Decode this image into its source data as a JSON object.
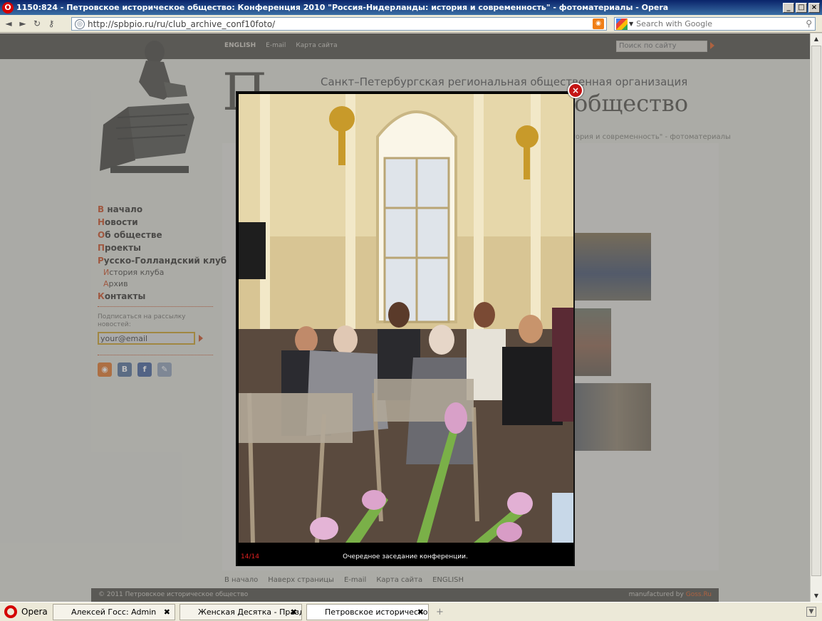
{
  "window": {
    "title": "1150:824 - Петровское историческое общество: Конференция 2010 \"Россия-Нидерланды: история и современность\" - фотоматериалы - Opera"
  },
  "address_bar": {
    "url": "http://spbpio.ru/ru/club_archive_conf10foto/",
    "search_placeholder": "Search with Google"
  },
  "site": {
    "top_links": {
      "english": "ENGLISH",
      "email": "E-mail",
      "sitemap": "Карта сайта"
    },
    "site_search_placeholder": "Поиск по сайту",
    "org_line": "Санкт–Петербургская региональная общественная организация",
    "header_big_letter": "П",
    "header_big_word": "общество",
    "breadcrumb_tail": "история и современность\" - фотоматериалы",
    "menu": [
      {
        "first": "В",
        "rest": " начало"
      },
      {
        "first": "Н",
        "rest": "овости"
      },
      {
        "first": "О",
        "rest": "б обществе"
      },
      {
        "first": "П",
        "rest": "роекты"
      },
      {
        "first": "Р",
        "rest": "усско-Голландский клуб"
      }
    ],
    "submenu": [
      {
        "first": "И",
        "rest": "стория клуба"
      },
      {
        "first": "А",
        "rest": "рхив"
      }
    ],
    "menu_last": {
      "first": "К",
      "rest": "онтакты"
    },
    "subscribe_label": "Подписаться на рассылку новостей:",
    "email_value": "your@email",
    "social": [
      "rss-icon",
      "vkontakte-icon",
      "facebook-icon",
      "livejournal-icon"
    ],
    "footer_links": [
      "В начало",
      "Наверх страницы",
      "E-mail",
      "Карта сайта",
      "ENGLISH"
    ],
    "copyright": "© 2011 Петровское историческое общество",
    "manufactured_label": "manufactured by",
    "manufactured_by": "Goss.Ru"
  },
  "lightbox": {
    "counter": "14/14",
    "caption": "Очередное заседание конференции."
  },
  "taskbar": {
    "start_label": "Opera",
    "tabs": [
      "Алексей Госс: Admin",
      "Женская Десятка - Праздни...",
      "Петровское историческое о..."
    ]
  },
  "colors": {
    "accent": "#c8461a",
    "header_bar": "#4a4741",
    "counter": "#e02020",
    "close_button": "#c41414"
  }
}
